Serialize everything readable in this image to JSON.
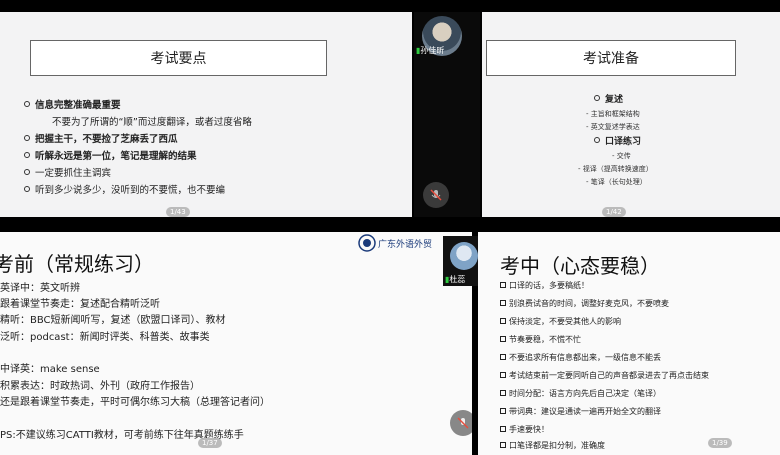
{
  "slide1": {
    "title": "考试要点",
    "bullets": [
      {
        "text": "信息完整准确最重要",
        "bold": true
      },
      {
        "text": "不要为了所谓的“顺”而过度翻译，或者过度省略",
        "indent": true
      },
      {
        "text": "把握主干，不要捡了芝麻丢了西瓜",
        "bold": true
      },
      {
        "text": "听解永远是第一位，笔记是理解的结果",
        "bold": true
      },
      {
        "text": "一定要抓住主调宾",
        "bold": false
      },
      {
        "text": "听到多少说多少，没听到的不要慌，也不要编",
        "bold": false
      }
    ],
    "page": "1/43"
  },
  "slide2": {
    "title": "考试准备",
    "items": [
      {
        "text": "复述",
        "type": "head"
      },
      {
        "text": "主旨和框架结构",
        "type": "sub"
      },
      {
        "text": "英文复述学表达",
        "type": "sub"
      },
      {
        "text": "口译练习",
        "type": "head"
      },
      {
        "text": "交传",
        "type": "sub2"
      },
      {
        "text": "视译（提高转换速度）",
        "type": "sub"
      },
      {
        "text": "笔译（长句处理）",
        "type": "sub"
      }
    ],
    "page": "1/42"
  },
  "slide3": {
    "title": "考前（常规练习）",
    "lines": [
      "英译中：英文听辨",
      "跟着课堂节奏走：复述配合精听泛听",
      "精听：BBC短新闻听写，复述（欧盟口译司）、教材",
      "泛听：podcast：新闻时评类、科普类、故事类",
      "",
      "中译英：make sense",
      "积累表达：时政热词、外刊（政府工作报告）",
      "还是跟着课堂节奏走，平时可偶尔练习大稿（总理答记者问）",
      "",
      "PS:不建议练习CATTI教材，可考前练下往年真题练练手"
    ],
    "logo_text": "广东外语外贸",
    "page": "1/37"
  },
  "slide4": {
    "title": "考中（心态要稳）",
    "items": [
      "口译的话，多要稿纸！",
      "别浪费试音的时间，调整好麦克风，不要喷麦",
      "保持淡定，不要受其他人的影响",
      "节奏要稳，不慌不忙",
      "不要追求所有信息都出来，一级信息不能丢",
      "考试结束前一定要同听自己的声音都录进去了再点击结束",
      "时间分配：语言方向先后自己决定（笔译）",
      "带词典：建议是通读一遍再开始全文的翻译",
      "手速要快！",
      "口笔译都是扣分制，准确度"
    ],
    "page": "1/39"
  },
  "participants": {
    "top_name": "孙佳昕",
    "mid_name": "杜蕊"
  }
}
